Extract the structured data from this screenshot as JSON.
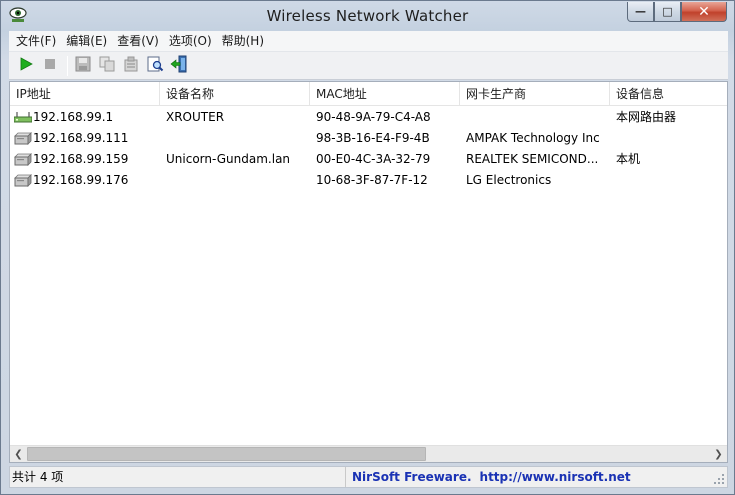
{
  "window": {
    "title": "Wireless Network Watcher",
    "minimize_glyph": "—",
    "maximize_glyph": "□",
    "close_glyph": "✕"
  },
  "menu": [
    "文件(F)",
    "编辑(E)",
    "查看(V)",
    "选项(O)",
    "帮助(H)"
  ],
  "toolbar": {
    "icons": [
      "play-icon",
      "stop-icon",
      "save-icon",
      "copy-icon",
      "properties-icon",
      "find-icon",
      "exit-icon"
    ]
  },
  "table": {
    "headers": [
      "IP地址",
      "设备名称",
      "MAC地址",
      "网卡生产商",
      "设备信息"
    ],
    "rows": [
      {
        "icon": "router-icon",
        "ip": "192.168.99.1",
        "name": "XROUTER",
        "mac": "90-48-9A-79-C4-A8",
        "vendor": "",
        "info": "本网路由器"
      },
      {
        "icon": "computer-icon",
        "ip": "192.168.99.111",
        "name": "",
        "mac": "98-3B-16-E4-F9-4B",
        "vendor": "AMPAK Technology Inc",
        "info": ""
      },
      {
        "icon": "computer-icon",
        "ip": "192.168.99.159",
        "name": "Unicorn-Gundam.lan",
        "mac": "00-E0-4C-3A-32-79",
        "vendor": "REALTEK SEMICOND...",
        "info": "本机"
      },
      {
        "icon": "computer-icon",
        "ip": "192.168.99.176",
        "name": "",
        "mac": "10-68-3F-87-7F-12",
        "vendor": "LG Electronics",
        "info": ""
      }
    ]
  },
  "status": {
    "count": "共计 4 项",
    "credit": "NirSoft Freeware.",
    "url": "http://www.nirsoft.net"
  },
  "colors": {
    "accent_link": "#1a32b4",
    "play_green": "#1fae1f"
  }
}
